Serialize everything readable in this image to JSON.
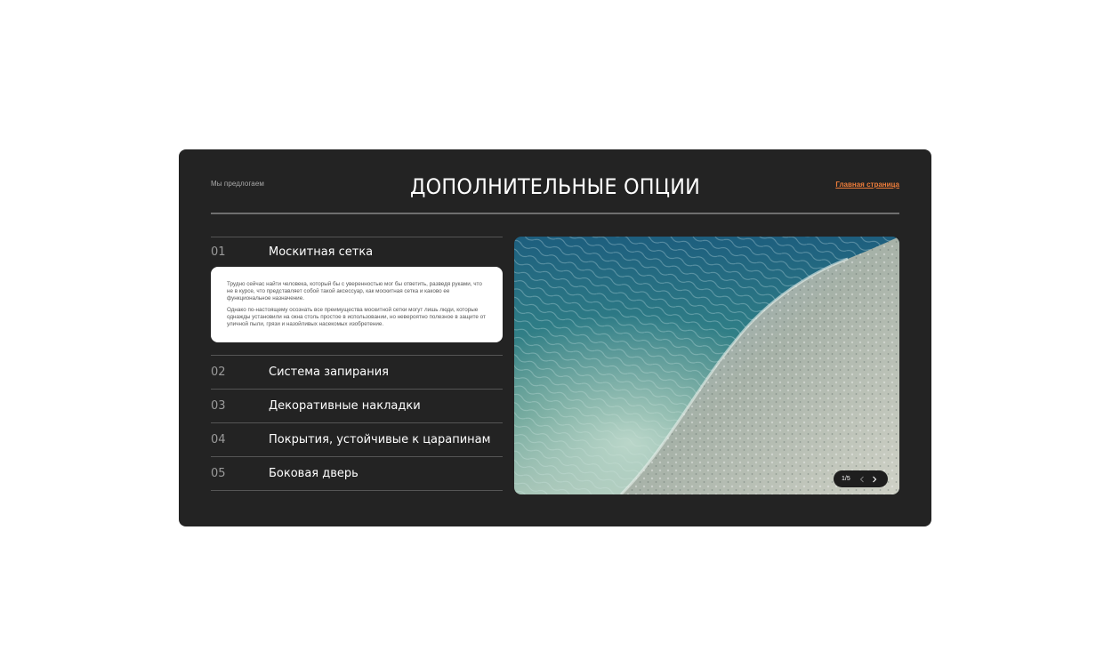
{
  "header": {
    "eyebrow": "Мы предлогаем",
    "title": "ДОПОЛНИТЕЛЬНЫЕ ОПЦИИ",
    "home_link": "Главная страница"
  },
  "options": [
    {
      "num": "01",
      "label": "Москитная сетка",
      "expanded": true,
      "paragraphs": [
        "Трудно сейчас найти человека, который бы с уверенностью мог бы ответить, разведя руками, что не в курсе, что представляет собой такой аксессуар, как москитная сетка и каково ее функциональное назначение.",
        "Однако по-настоящему осознать все преимущества москитной сетки могут лишь люди, которые однажды установили на окна столь простое в использовании, но невероятно полезное в защите от уличной пыли, грязи и назойливых насекомых изобретение."
      ]
    },
    {
      "num": "02",
      "label": "Система запирания",
      "expanded": false
    },
    {
      "num": "03",
      "label": "Декоративные накладки",
      "expanded": false
    },
    {
      "num": "04",
      "label": "Покрытия, устойчивые к царапинам",
      "expanded": false
    },
    {
      "num": "05",
      "label": "Боковая дверь",
      "expanded": false
    }
  ],
  "slider": {
    "counter": "1/5",
    "prev_icon": "chevron-left-icon",
    "next_icon": "chevron-right-icon",
    "image": "ocean-wave-photo"
  },
  "colors": {
    "card_bg": "#232323",
    "accent": "#ee7d3a",
    "body_text": "#555555"
  }
}
